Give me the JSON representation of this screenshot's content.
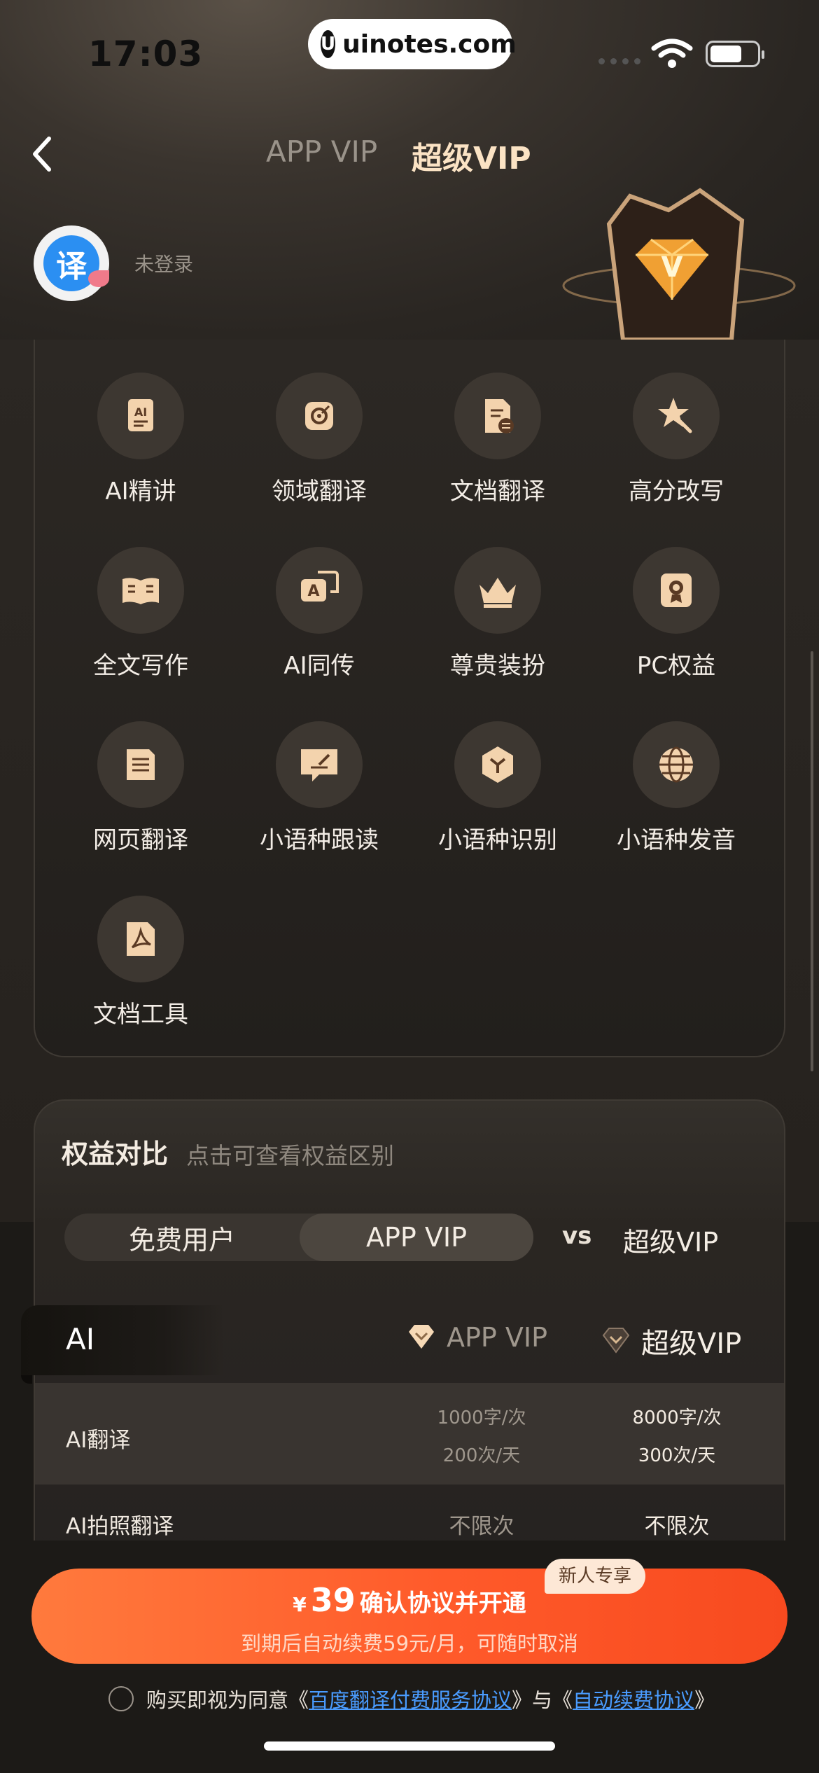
{
  "status_bar": {
    "time": "17:03",
    "watermark": "uinotes.com",
    "watermark_logo": "U"
  },
  "nav": {
    "tab_app": "APP VIP",
    "tab_super": "超级VIP"
  },
  "user": {
    "avatar_char": "译",
    "login_status": "未登录"
  },
  "features": [
    {
      "label": "AI精讲",
      "icon": "ai-lecture-icon"
    },
    {
      "label": "领域翻译",
      "icon": "target-icon"
    },
    {
      "label": "文档翻译",
      "icon": "document-translate-icon"
    },
    {
      "label": "高分改写",
      "icon": "magic-star-icon"
    },
    {
      "label": "全文写作",
      "icon": "open-book-icon"
    },
    {
      "label": "AI同传",
      "icon": "simultaneous-interpret-icon"
    },
    {
      "label": "尊贵装扮",
      "icon": "crown-icon"
    },
    {
      "label": "PC权益",
      "icon": "certificate-icon"
    },
    {
      "label": "网页翻译",
      "icon": "webpage-icon"
    },
    {
      "label": "小语种跟读",
      "icon": "chat-pen-icon"
    },
    {
      "label": "小语种识别",
      "icon": "cube-icon"
    },
    {
      "label": "小语种发音",
      "icon": "globe-icon"
    },
    {
      "label": "文档工具",
      "icon": "pdf-icon"
    }
  ],
  "compare": {
    "title": "权益对比",
    "subtitle": "点击可查看权益区别",
    "seg_free": "免费用户",
    "seg_app": "APP VIP",
    "vs": "vs",
    "seg_super": "超级VIP",
    "section": "AI",
    "col_app": "APP VIP",
    "col_super": "超级VIP",
    "rows": [
      {
        "label": "AI翻译",
        "app_1": "1000字/次",
        "app_2": "200次/天",
        "super_1": "8000字/次",
        "super_2": "300次/天"
      },
      {
        "label": "AI拍照翻译",
        "app_1": "不限次",
        "super_1": "不限次"
      }
    ]
  },
  "purchase": {
    "yen": "¥",
    "price": "39",
    "button_text": "确认协议并开通",
    "sub_text": "到期后自动续费59元/月，可随时取消",
    "badge": "新人专享",
    "agree_prefix": "购买即视为同意《",
    "agreement1": "百度翻译付费服务协议",
    "agree_mid": "》与《",
    "agreement2": "自动续费协议",
    "agree_suffix": "》"
  },
  "colors": {
    "accent_gold": "#fbe3c4",
    "cta_orange": "#ff5a2a",
    "link_blue": "#4a9cff"
  }
}
